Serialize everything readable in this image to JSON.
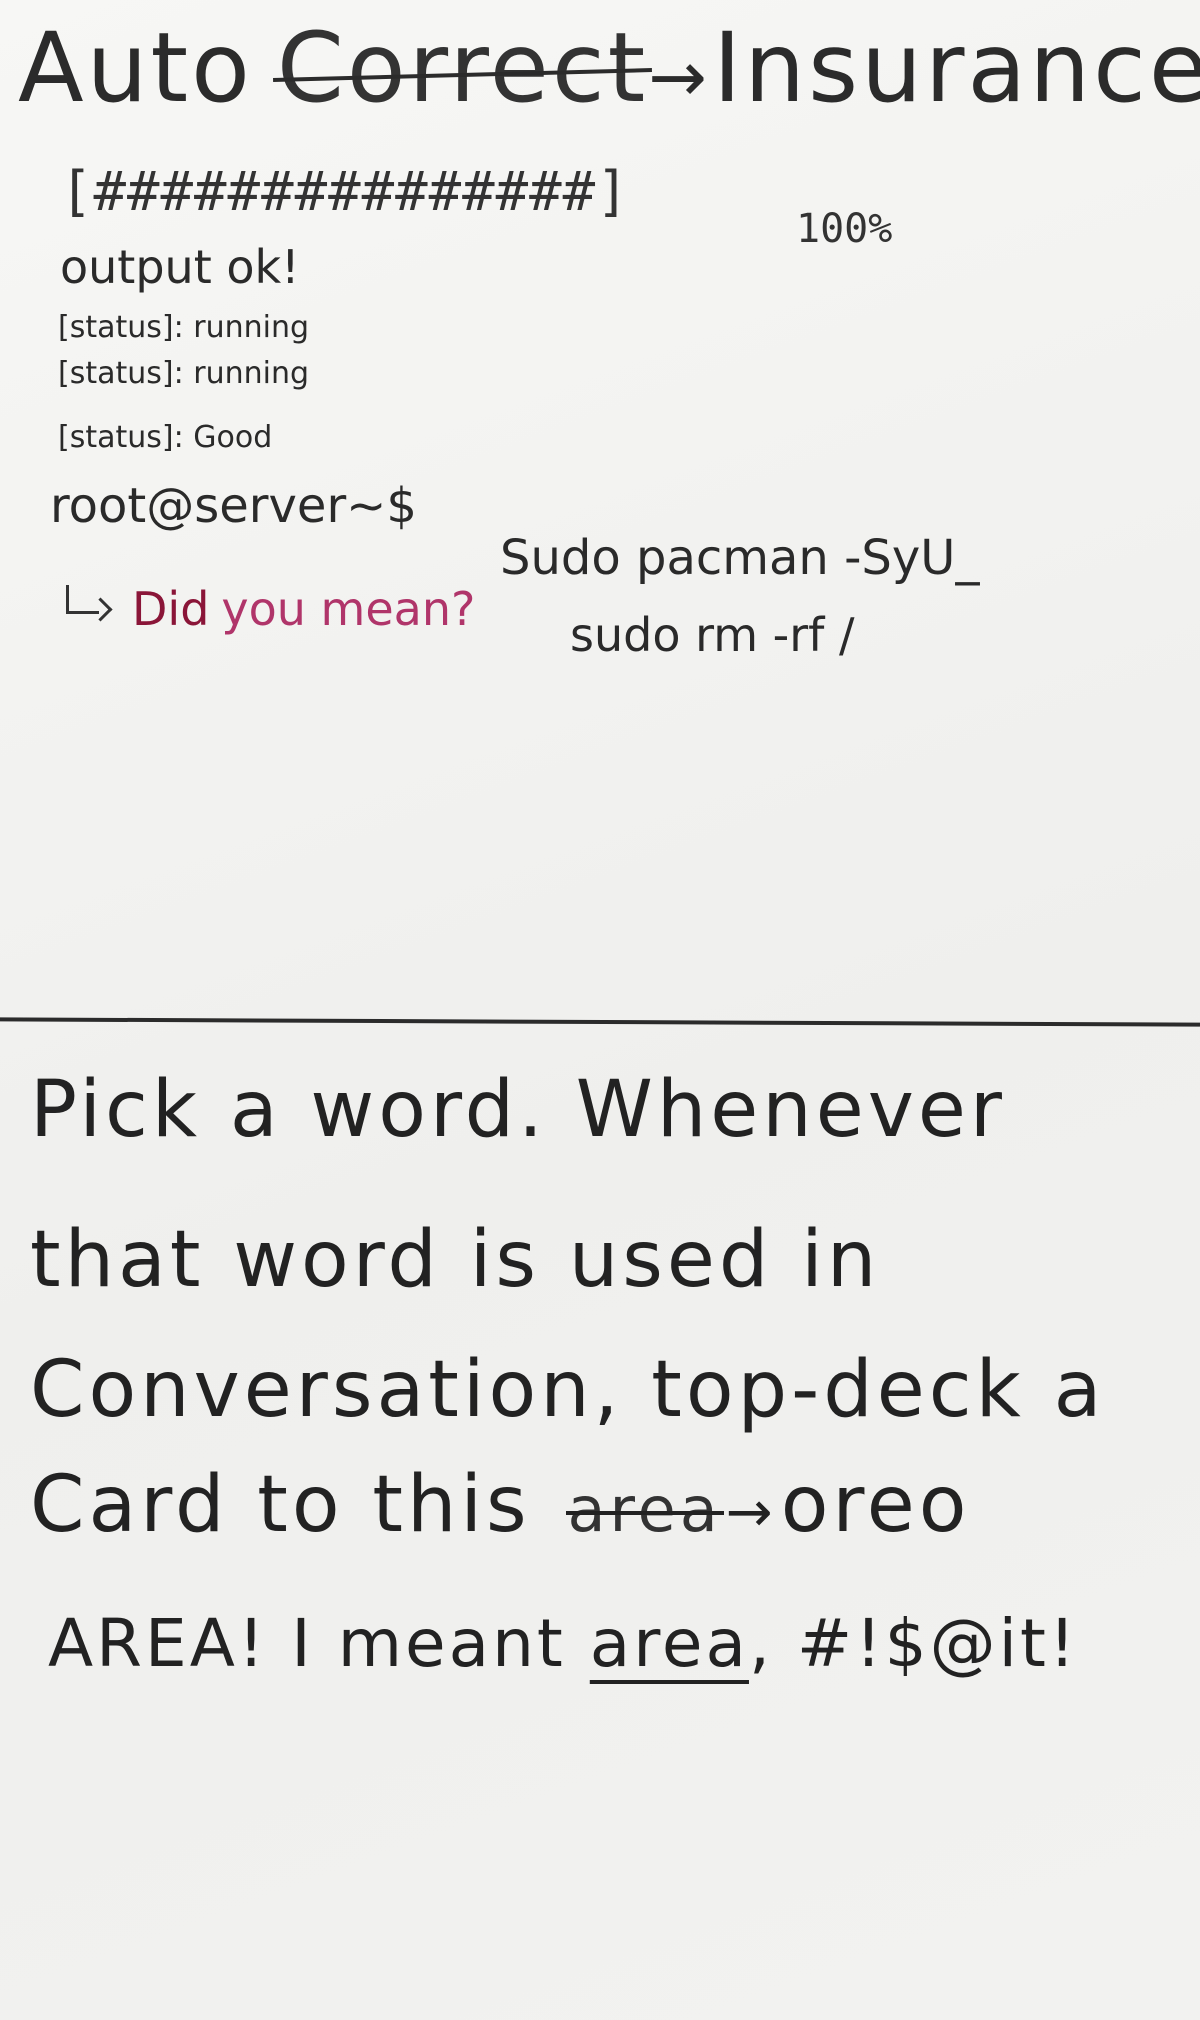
{
  "title": {
    "prefix": "Auto",
    "struck_word": "Correct",
    "arrow": "→",
    "replacement": "Insurance"
  },
  "terminal": {
    "progress_bar": "[###############]",
    "progress_percent": "100%",
    "output_line": "output ok!",
    "status_lines": [
      "[status]: running",
      "[status]: running",
      "[status]: Good"
    ],
    "prompt": "root@server~$",
    "command": "Sudo pacman -SyU_",
    "suggestion_arrow": "↳",
    "suggestion_did": "Did",
    "suggestion_mean": "you mean?",
    "suggested_command": "sudo rm -rf /"
  },
  "rules": {
    "line1": "Pick a word. Whenever",
    "line2": "that word is used in",
    "line3": "Conversation, top-deck a",
    "line4_start": "Card to this",
    "line4_struck": "area",
    "line4_arrow": "→",
    "line4_end": "oreo",
    "punch_start": "AREA! I meant ",
    "punch_underlined": "area",
    "punch_end": ", #!$@it!"
  }
}
